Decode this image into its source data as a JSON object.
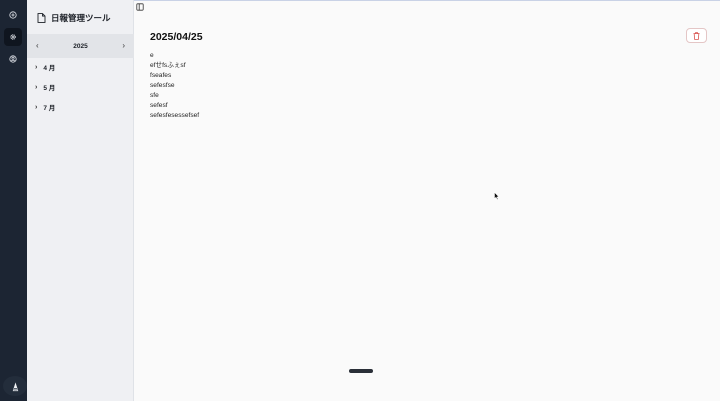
{
  "app": {
    "title": "日報管理ツール"
  },
  "rail": {
    "items": [
      {
        "icon": "circle-plus-icon"
      },
      {
        "icon": "gear-icon"
      },
      {
        "icon": "user-icon"
      }
    ],
    "logo_icon": "app-logo-icon"
  },
  "sidebar": {
    "year": "2025",
    "prev_icon": "chevron-left-icon",
    "next_icon": "chevron-right-icon",
    "months": [
      {
        "label": "4 月"
      },
      {
        "label": "5 月"
      },
      {
        "label": "7 月"
      }
    ]
  },
  "report": {
    "date": "2025/04/25",
    "delete_icon": "trash-icon",
    "lines": [
      "e",
      "efせfsふぇsf",
      "fseafes",
      "sefesfse",
      "sfe",
      "sefesf",
      "sefesfesessefsef"
    ]
  },
  "colors": {
    "rail_bg": "#1c2533",
    "sidebar_bg": "#eff0f3",
    "year_bar_bg": "#e2e4e8",
    "delete_accent": "#d9534f",
    "content_bg": "#fafafa"
  }
}
